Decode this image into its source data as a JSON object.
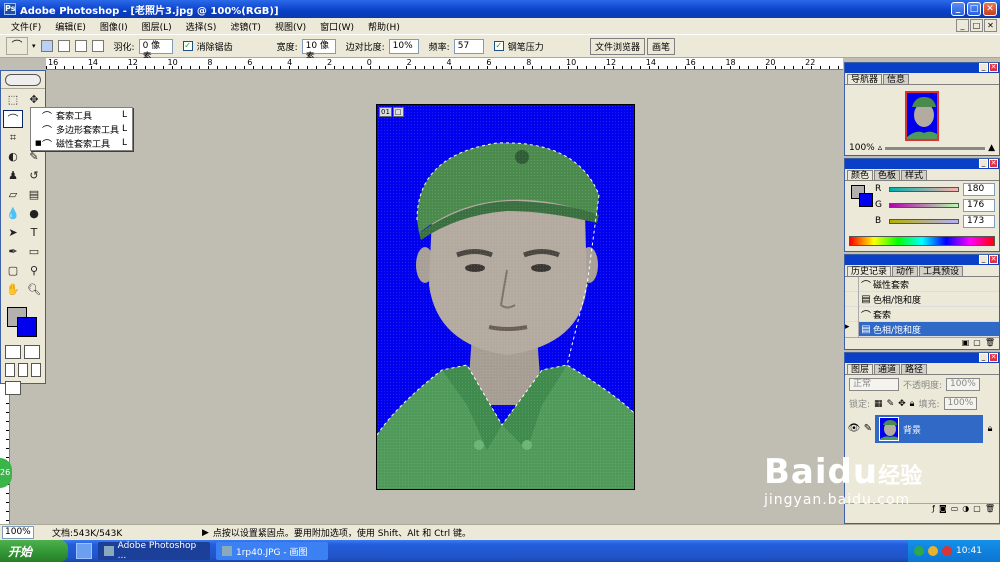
{
  "window": {
    "title": "Adobe Photoshop - [老照片3.jpg @ 100%(RGB)]",
    "app_icon": "Ps"
  },
  "menu": [
    "文件(F)",
    "编辑(E)",
    "图像(I)",
    "图层(L)",
    "选择(S)",
    "滤镜(T)",
    "视图(V)",
    "窗口(W)",
    "帮助(H)"
  ],
  "options": {
    "feather_label": "羽化:",
    "feather_value": "0 像素",
    "antialias_label": "消除锯齿",
    "width_label": "宽度:",
    "width_value": "10 像素",
    "edge_contrast_label": "边对比度:",
    "edge_contrast_value": "10%",
    "frequency_label": "频率:",
    "frequency_value": "57",
    "pen_pressure_label": "钢笔压力",
    "well_tabs": [
      "文件浏览器",
      "画笔"
    ]
  },
  "ruler": {
    "h_labels": [
      "16",
      "14",
      "12",
      "10",
      "8",
      "6",
      "4",
      "2",
      "0",
      "2",
      "4",
      "6",
      "8",
      "10",
      "12",
      "14",
      "16",
      "18",
      "20",
      "22"
    ]
  },
  "flyout": {
    "items": [
      {
        "bullet": "",
        "label": "套索工具",
        "key": "L"
      },
      {
        "bullet": "",
        "label": "多边形套索工具",
        "key": "L"
      },
      {
        "bullet": "■",
        "label": "磁性套索工具",
        "key": "L"
      }
    ]
  },
  "canvas": {
    "indicators": [
      "01",
      "□"
    ]
  },
  "navigator": {
    "tabs": [
      "导航器",
      "信息"
    ],
    "zoom": "100%"
  },
  "color_panel": {
    "tabs": [
      "颜色",
      "色板",
      "样式"
    ],
    "r_label": "R",
    "r_value": "180",
    "g_label": "G",
    "g_value": "176",
    "b_label": "B",
    "b_value": "173",
    "fg_color": "#b4b0ad",
    "bg_color": "#0000ee"
  },
  "history": {
    "tabs": [
      "历史记录",
      "动作",
      "工具预设"
    ],
    "items": [
      "磁性套索",
      "色相/饱和度",
      "套索",
      "色相/饱和度"
    ]
  },
  "layers": {
    "tabs": [
      "图层",
      "通道",
      "路径"
    ],
    "blend_mode": "正常",
    "opacity_label": "不透明度:",
    "opacity_value": "100%",
    "lock_label": "锁定:",
    "fill_label": "填充:",
    "fill_value": "100%",
    "layer_name": "背景"
  },
  "status": {
    "zoom": "100%",
    "doc_size": "文档:543K/543K",
    "hint": "点按以设置紧固点。要用附加选项，使用 Shift、Alt 和 Ctrl 键。"
  },
  "taskbar": {
    "start": "开始",
    "tasks": [
      "Adobe Photoshop ...",
      "1rp40.JPG - 画图"
    ],
    "time": "10:41"
  },
  "watermark": {
    "brand": "Baidu",
    "jy": "经验",
    "url": "jingyan.baidu.com"
  },
  "badge": "26"
}
